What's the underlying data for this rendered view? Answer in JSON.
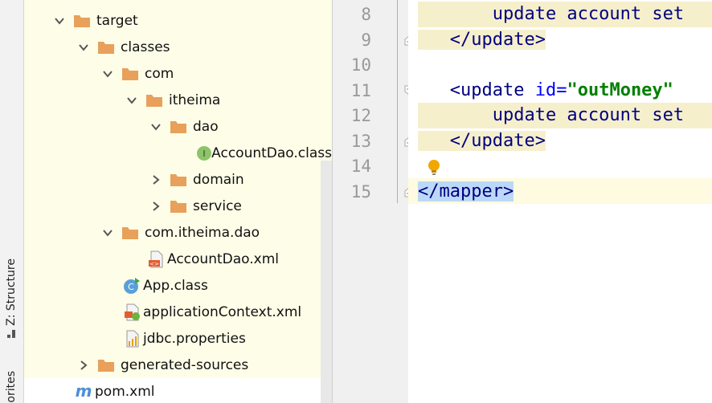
{
  "tool_strip": {
    "structure_tab": "Z: Structure",
    "favorites_tab": "orites"
  },
  "tree": {
    "items": [
      {
        "label": "target",
        "kind": "folder",
        "expanded": true
      },
      {
        "label": "classes",
        "kind": "folder",
        "expanded": true
      },
      {
        "label": "com",
        "kind": "folder",
        "expanded": true
      },
      {
        "label": "itheima",
        "kind": "folder",
        "expanded": true
      },
      {
        "label": "dao",
        "kind": "folder",
        "expanded": true
      },
      {
        "label": "AccountDao.class",
        "kind": "interface-class-file"
      },
      {
        "label": "domain",
        "kind": "folder",
        "expanded": false
      },
      {
        "label": "service",
        "kind": "folder",
        "expanded": false
      },
      {
        "label": "com.itheima.dao",
        "kind": "folder",
        "expanded": true
      },
      {
        "label": "AccountDao.xml",
        "kind": "xml-file"
      },
      {
        "label": "App.class",
        "kind": "class-file"
      },
      {
        "label": "applicationContext.xml",
        "kind": "spring-xml-file"
      },
      {
        "label": "jdbc.properties",
        "kind": "properties-file"
      },
      {
        "label": "generated-sources",
        "kind": "folder",
        "expanded": false
      },
      {
        "label": "pom.xml",
        "kind": "maven-file"
      }
    ]
  },
  "editor": {
    "line_numbers": [
      "8",
      "9",
      "10",
      "11",
      "12",
      "13",
      "14",
      "15"
    ],
    "lines": {
      "l8": "update account set",
      "l9_tag": "</update>",
      "l11_open": "<update ",
      "l11_attr": "id=",
      "l11_val": "\"outMoney\"",
      "l12": "update account set",
      "l13_tag": "</update>",
      "l15_tag": "</mapper>"
    }
  },
  "colors": {
    "tree_bg": "#fdfde8",
    "folder": "#e8a05a",
    "tag_text": "#000080",
    "string_value": "#008000",
    "selection": "#bcd8f8",
    "bulb": "#f0a800"
  }
}
